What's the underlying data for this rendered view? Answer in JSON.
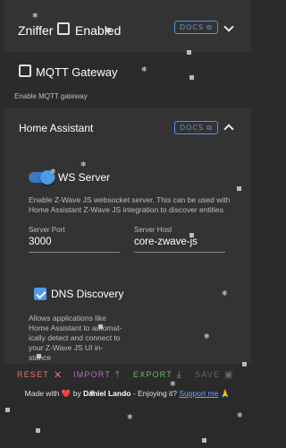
{
  "zniffer": {
    "label": "Zniffer",
    "enabled_label": "Enabled",
    "enabled": false,
    "docs_label": "DOCS"
  },
  "mqtt": {
    "label": "MQTT Gateway",
    "checked": false,
    "help": "Enable MQTT gateway"
  },
  "home_assistant": {
    "title": "Home Assistant",
    "docs_label": "DOCS",
    "ws_server": {
      "label": "WS Server",
      "enabled": true,
      "help": "Enable Z-Wave JS websocket server. This can be used with Home Assistant Z-Wave JS integration to discover entities"
    },
    "server_port": {
      "label": "Server Port",
      "value": "3000"
    },
    "server_host": {
      "label": "Server Host",
      "value": "core-zwave-js"
    },
    "dns_discovery": {
      "label": "DNS Discovery",
      "checked": true,
      "help_lines": [
        "Allows applications like",
        "Home Assistant to automat-",
        "ically detect and connect to",
        "your Z-Wave JS UI in-",
        "stance"
      ]
    }
  },
  "actions": {
    "reset": {
      "label": "RESET",
      "color": "#e57373"
    },
    "import": {
      "label": "IMPORT",
      "color": "#ba68c8"
    },
    "export": {
      "label": "EXPORT",
      "color": "#66bb6a"
    },
    "save": {
      "label": "SAVE",
      "color": "#5a6a7a"
    }
  },
  "footer": {
    "made_with": "Made with",
    "by": "by",
    "author": "Daniel Lando",
    "enjoying": "- Enjoying it?",
    "support_link": "Support me",
    "heart_emoji": "❤️",
    "pray_emoji": "🙏"
  },
  "colors": {
    "accent": "#4d9be6",
    "panel": "#333333",
    "background": "#2b2b2b",
    "link": "#6aa3ff"
  }
}
